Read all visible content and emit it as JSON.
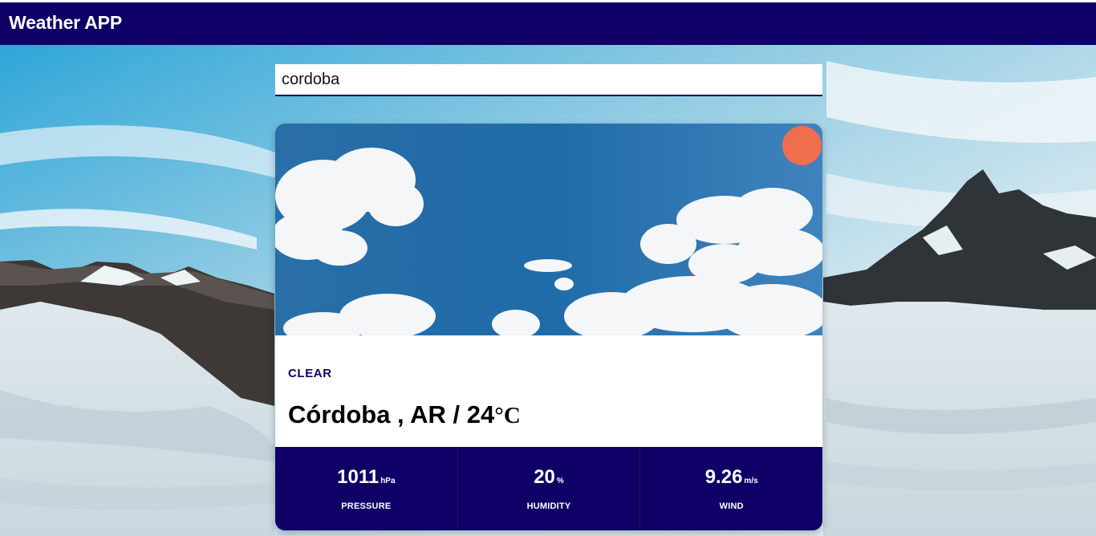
{
  "app": {
    "title": "Weather APP"
  },
  "search": {
    "value": "cordoba"
  },
  "weather": {
    "condition": "CLEAR",
    "location": "Córdoba , AR / 24",
    "temp_unit": "°C",
    "stats": [
      {
        "value": "1011",
        "unit": "hPa",
        "label": "PRESSURE"
      },
      {
        "value": "20",
        "unit": "%",
        "label": "HUMIDITY"
      },
      {
        "value": "9.26",
        "unit": "m/s",
        "label": "WIND"
      }
    ]
  },
  "colors": {
    "navbar": "#0e0066",
    "sun": "#ee6e4d",
    "stats_bg": "#0e0066"
  },
  "icons": {
    "sun": "sun-icon"
  }
}
